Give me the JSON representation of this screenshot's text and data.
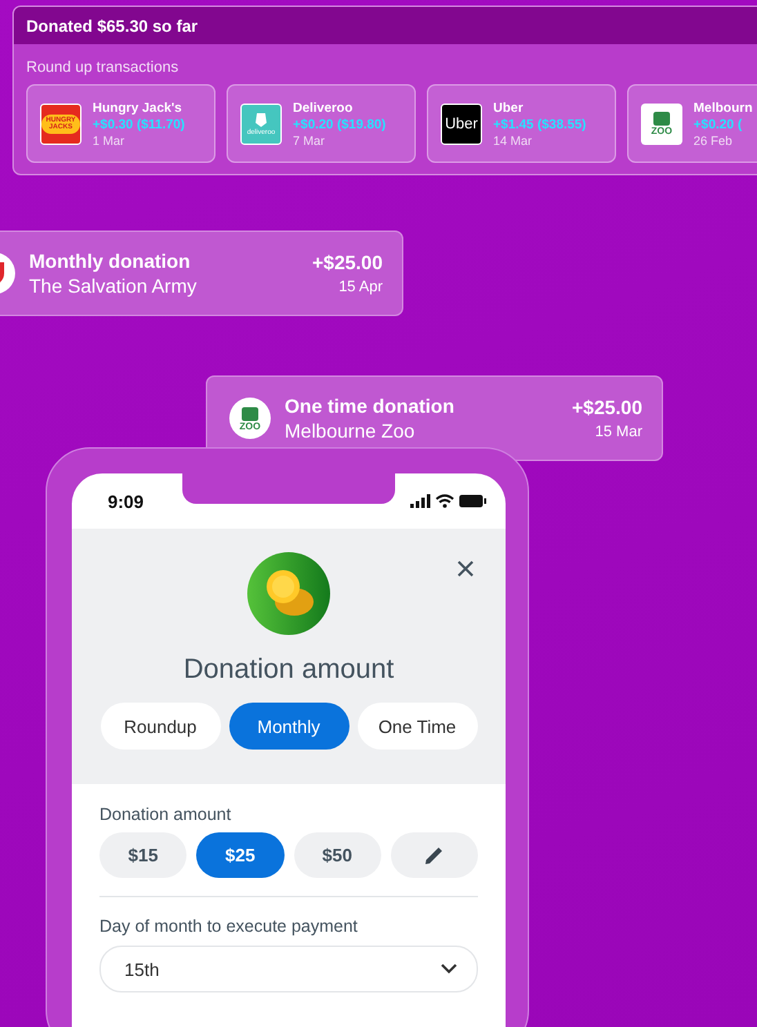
{
  "summary_panel": {
    "title": "Donated $65.30 so far",
    "subtitle": "Round up transactions",
    "transactions": [
      {
        "kind": "burger",
        "logo_text": "HUNGRY JACKS",
        "merchant": "Hungry Jack's",
        "amount": "+$0.30 ($11.70)",
        "date": "1 Mar"
      },
      {
        "kind": "delivery",
        "logo_text": "deliveroo",
        "merchant": "Deliveroo",
        "amount": "+$0.20 ($19.80)",
        "date": "7 Mar"
      },
      {
        "kind": "ride",
        "logo_text": "Uber",
        "merchant": "Uber",
        "amount": "+$1.45 ($38.55)",
        "date": "14 Mar"
      },
      {
        "kind": "zoo",
        "logo_text": "ZOO",
        "merchant": "Melbourn",
        "amount": "+$0.20 (",
        "date": "26 Feb"
      }
    ]
  },
  "donation_cards": [
    {
      "kind": "shield",
      "title": "Monthly donation",
      "org": "The Salvation Army",
      "amount": "+$25.00",
      "date": "15 Apr"
    },
    {
      "kind": "zoo",
      "logo_text": "ZOO",
      "title": "One time donation",
      "org": "Melbourne Zoo",
      "amount": "+$25.00",
      "date": "15 Mar"
    }
  ],
  "phone": {
    "time": "9:09",
    "sheet_title": "Donation amount",
    "tabs": [
      {
        "label": "Roundup",
        "selected": false
      },
      {
        "label": "Monthly",
        "selected": true
      },
      {
        "label": "One Time",
        "selected": false
      }
    ],
    "amount_label": "Donation amount",
    "amounts": [
      {
        "kind": "value",
        "label": "$15",
        "selected": false
      },
      {
        "kind": "value",
        "label": "$25",
        "selected": true
      },
      {
        "kind": "value",
        "label": "$50",
        "selected": false
      },
      {
        "kind": "edit",
        "selected": false
      }
    ],
    "day_label": "Day of month to execute payment",
    "day_value": "15th"
  }
}
